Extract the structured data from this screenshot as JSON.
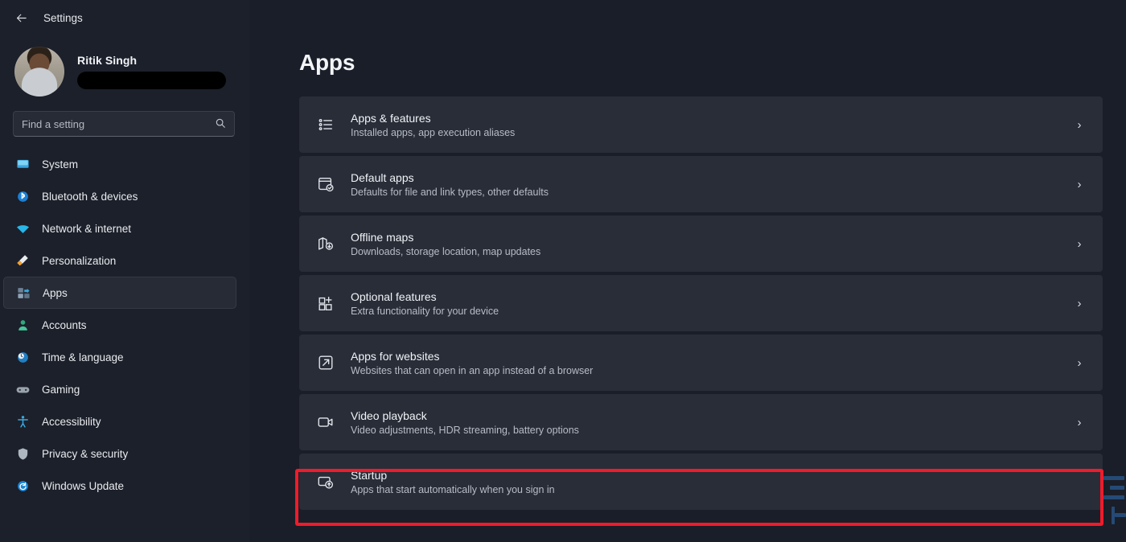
{
  "window": {
    "back_label": "←",
    "title": "Settings"
  },
  "profile": {
    "name": "Ritik Singh",
    "email_redacted": ""
  },
  "search": {
    "placeholder": "Find a setting",
    "value": "",
    "icon": "search-icon"
  },
  "sidebar": {
    "items": [
      {
        "label": "System",
        "icon": "monitor-icon",
        "selected": false
      },
      {
        "label": "Bluetooth & devices",
        "icon": "bluetooth-icon",
        "selected": false
      },
      {
        "label": "Network & internet",
        "icon": "wifi-icon",
        "selected": false
      },
      {
        "label": "Personalization",
        "icon": "paintbrush-icon",
        "selected": false
      },
      {
        "label": "Apps",
        "icon": "apps-icon",
        "selected": true
      },
      {
        "label": "Accounts",
        "icon": "person-icon",
        "selected": false
      },
      {
        "label": "Time & language",
        "icon": "clock-globe-icon",
        "selected": false
      },
      {
        "label": "Gaming",
        "icon": "gamepad-icon",
        "selected": false
      },
      {
        "label": "Accessibility",
        "icon": "accessibility-icon",
        "selected": false
      },
      {
        "label": "Privacy & security",
        "icon": "shield-icon",
        "selected": false
      },
      {
        "label": "Windows Update",
        "icon": "update-icon",
        "selected": false
      }
    ]
  },
  "main": {
    "page_title": "Apps",
    "cards": [
      {
        "title": "Apps & features",
        "subtitle": "Installed apps, app execution aliases",
        "icon": "list-bullets-icon",
        "chevron": "›",
        "highlighted": false
      },
      {
        "title": "Default apps",
        "subtitle": "Defaults for file and link types, other defaults",
        "icon": "default-apps-icon",
        "chevron": "›",
        "highlighted": false
      },
      {
        "title": "Offline maps",
        "subtitle": "Downloads, storage location, map updates",
        "icon": "map-download-icon",
        "chevron": "›",
        "highlighted": false
      },
      {
        "title": "Optional features",
        "subtitle": "Extra functionality for your device",
        "icon": "add-square-icon",
        "chevron": "›",
        "highlighted": false
      },
      {
        "title": "Apps for websites",
        "subtitle": "Websites that can open in an app instead of a browser",
        "icon": "open-external-icon",
        "chevron": "›",
        "highlighted": false
      },
      {
        "title": "Video playback",
        "subtitle": "Video adjustments, HDR streaming, battery options",
        "icon": "video-camera-icon",
        "chevron": "›",
        "highlighted": false
      },
      {
        "title": "Startup",
        "subtitle": "Apps that start automatically when you sign in",
        "icon": "startup-icon",
        "chevron": "",
        "highlighted": true
      }
    ]
  },
  "colors": {
    "accent": "#4cc2ff",
    "highlight": "#f01b2b",
    "page_bg": "#1a1e28",
    "sidebar_bg": "#1c202a",
    "card_bg": "#282d38"
  }
}
